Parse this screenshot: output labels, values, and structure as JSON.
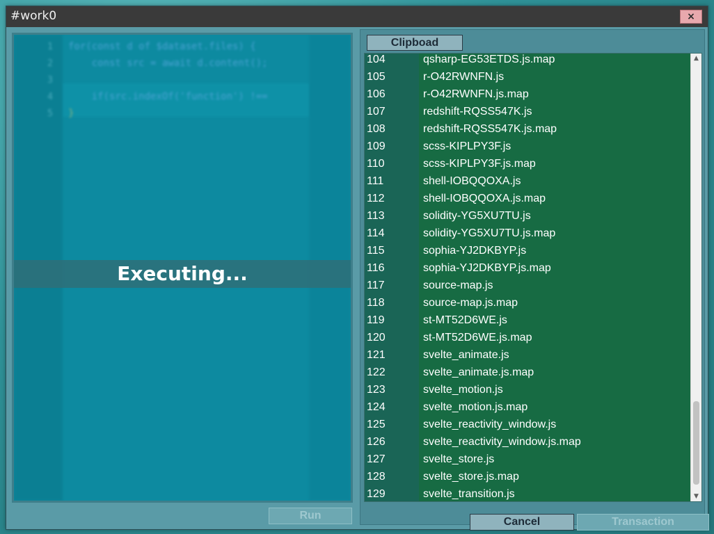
{
  "window": {
    "title": "#work0",
    "close_label": "×"
  },
  "editor": {
    "line_numbers": [
      "1",
      "2",
      "3",
      "4",
      "5"
    ],
    "status": "Executing...",
    "run_label": "Run",
    "code": [
      "for(const d of $dataset.files) {",
      "    const src = await d.content();",
      "",
      "    if(src.indexOf('function') !==",
      "}"
    ]
  },
  "clipboard": {
    "tab_label": "Clipboad",
    "rows": [
      {
        "num": "104",
        "name": "qsharp-EG53ETDS.js.map"
      },
      {
        "num": "105",
        "name": "r-O42RWNFN.js"
      },
      {
        "num": "106",
        "name": "r-O42RWNFN.js.map"
      },
      {
        "num": "107",
        "name": "redshift-RQSS547K.js"
      },
      {
        "num": "108",
        "name": "redshift-RQSS547K.js.map"
      },
      {
        "num": "109",
        "name": "scss-KIPLPY3F.js"
      },
      {
        "num": "110",
        "name": "scss-KIPLPY3F.js.map"
      },
      {
        "num": "111",
        "name": "shell-IOBQQOXA.js"
      },
      {
        "num": "112",
        "name": "shell-IOBQQOXA.js.map"
      },
      {
        "num": "113",
        "name": "solidity-YG5XU7TU.js"
      },
      {
        "num": "114",
        "name": "solidity-YG5XU7TU.js.map"
      },
      {
        "num": "115",
        "name": "sophia-YJ2DKBYP.js"
      },
      {
        "num": "116",
        "name": "sophia-YJ2DKBYP.js.map"
      },
      {
        "num": "117",
        "name": "source-map.js"
      },
      {
        "num": "118",
        "name": "source-map.js.map"
      },
      {
        "num": "119",
        "name": "st-MT52D6WE.js"
      },
      {
        "num": "120",
        "name": "st-MT52D6WE.js.map"
      },
      {
        "num": "121",
        "name": "svelte_animate.js"
      },
      {
        "num": "122",
        "name": "svelte_animate.js.map"
      },
      {
        "num": "123",
        "name": "svelte_motion.js"
      },
      {
        "num": "124",
        "name": "svelte_motion.js.map"
      },
      {
        "num": "125",
        "name": "svelte_reactivity_window.js"
      },
      {
        "num": "126",
        "name": "svelte_reactivity_window.js.map"
      },
      {
        "num": "127",
        "name": "svelte_store.js"
      },
      {
        "num": "128",
        "name": "svelte_store.js.map"
      },
      {
        "num": "129",
        "name": "svelte_transition.js"
      }
    ],
    "cancel_label": "Cancel",
    "transaction_label": "Transaction"
  },
  "colors": {
    "list_bg": "#176b43",
    "editor_bg": "#0d8aa0",
    "titlebar": "#3a3a3a",
    "close_button": "#e8a8ad"
  },
  "icons": {
    "scroll_up": "triangle-up-icon",
    "scroll_down": "triangle-down-icon"
  }
}
